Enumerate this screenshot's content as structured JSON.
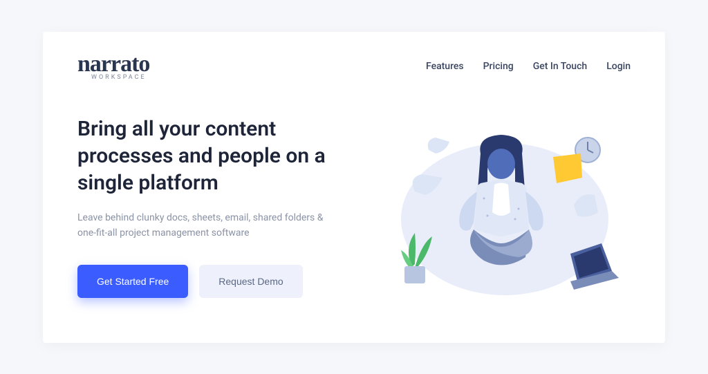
{
  "logo": {
    "main": "narrato",
    "sub": "WORKSPACE"
  },
  "nav": {
    "items": [
      {
        "label": "Features"
      },
      {
        "label": "Pricing"
      },
      {
        "label": "Get In Touch"
      },
      {
        "label": "Login"
      }
    ]
  },
  "hero": {
    "title": "Bring all your content processes and people on a single platform",
    "subtitle": "Leave behind clunky docs, sheets, email, shared folders & one-fit-all project management software"
  },
  "cta": {
    "primary": "Get Started Free",
    "secondary": "Request Demo"
  },
  "colors": {
    "primary": "#3b5cff",
    "secondary_bg": "#eef1fb",
    "text_dark": "#1e2538",
    "text_muted": "#8a92a5"
  }
}
